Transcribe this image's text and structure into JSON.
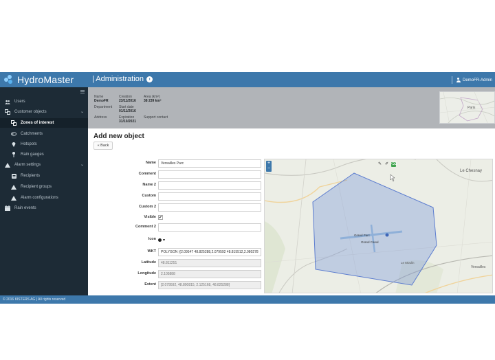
{
  "app": {
    "brand": "HydroMaster",
    "section_title": "| Administration",
    "user": "DemoFR-Admin"
  },
  "sidebar": {
    "items": [
      {
        "label": "Users",
        "icon": "users-icon"
      },
      {
        "label": "Customer objects",
        "icon": "objects-icon"
      },
      {
        "label": "Zones of interest",
        "icon": "zones-icon"
      },
      {
        "label": "Catchments",
        "icon": "catchment-icon"
      },
      {
        "label": "Hotspots",
        "icon": "pin-icon"
      },
      {
        "label": "Rain gauges",
        "icon": "rain-gauge-icon"
      },
      {
        "label": "Alarm settings",
        "icon": "warning-icon"
      },
      {
        "label": "Recipients",
        "icon": "recipient-icon"
      },
      {
        "label": "Recipient groups",
        "icon": "warning-icon"
      },
      {
        "label": "Alarm configurations",
        "icon": "warning-icon"
      },
      {
        "label": "Rain events",
        "icon": "calendar-icon"
      }
    ]
  },
  "info": {
    "name_label": "Name",
    "name_value": "DemoFR",
    "creation_label": "Creation",
    "creation_value": "23/11/2016",
    "area_label": "Area (km²)",
    "area_value": "38 239 km²",
    "department_label": "Department",
    "start_label": "Start date",
    "start_value": "01/11/2016",
    "address_label": "Address",
    "expiration_label": "Expiration",
    "expiration_value": "31/10/2021",
    "support_label": "Support contact"
  },
  "main": {
    "title": "Add new object",
    "back_label": "« Back"
  },
  "form": {
    "name_label": "Name",
    "name_value": "Versailles Parc",
    "comment_label": "Comment",
    "name2_label": "Name 2",
    "custom_label": "Custom",
    "custom2_label": "Custom 2",
    "visible_label": "Visible",
    "visible_checked": "✔",
    "comment2_label": "Comment 2",
    "icon_label": "Icon",
    "icon_caret": "▾",
    "wkt_label": "WKT",
    "wkt_value": "POLYGON ((2.09547 48.825288,2.079592 48.815512,2.080278",
    "latitude_label": "Latitude",
    "latitude_value": "48.811251",
    "longitude_label": "Longitude",
    "longitude_value": "2.105888",
    "extent_label": "Extent",
    "extent_value": "[2.079592, 48.800815, 2.125168, 48.825288]"
  },
  "map": {
    "labels": [
      "Le Chesnay",
      "Grand Parc",
      "Grand Canal",
      "Versailles",
      "Le Moulin"
    ],
    "polygon_color": "#6f8fd8"
  },
  "footer": {
    "text": "© 2016 KISTERS AG | All rights reserved"
  }
}
